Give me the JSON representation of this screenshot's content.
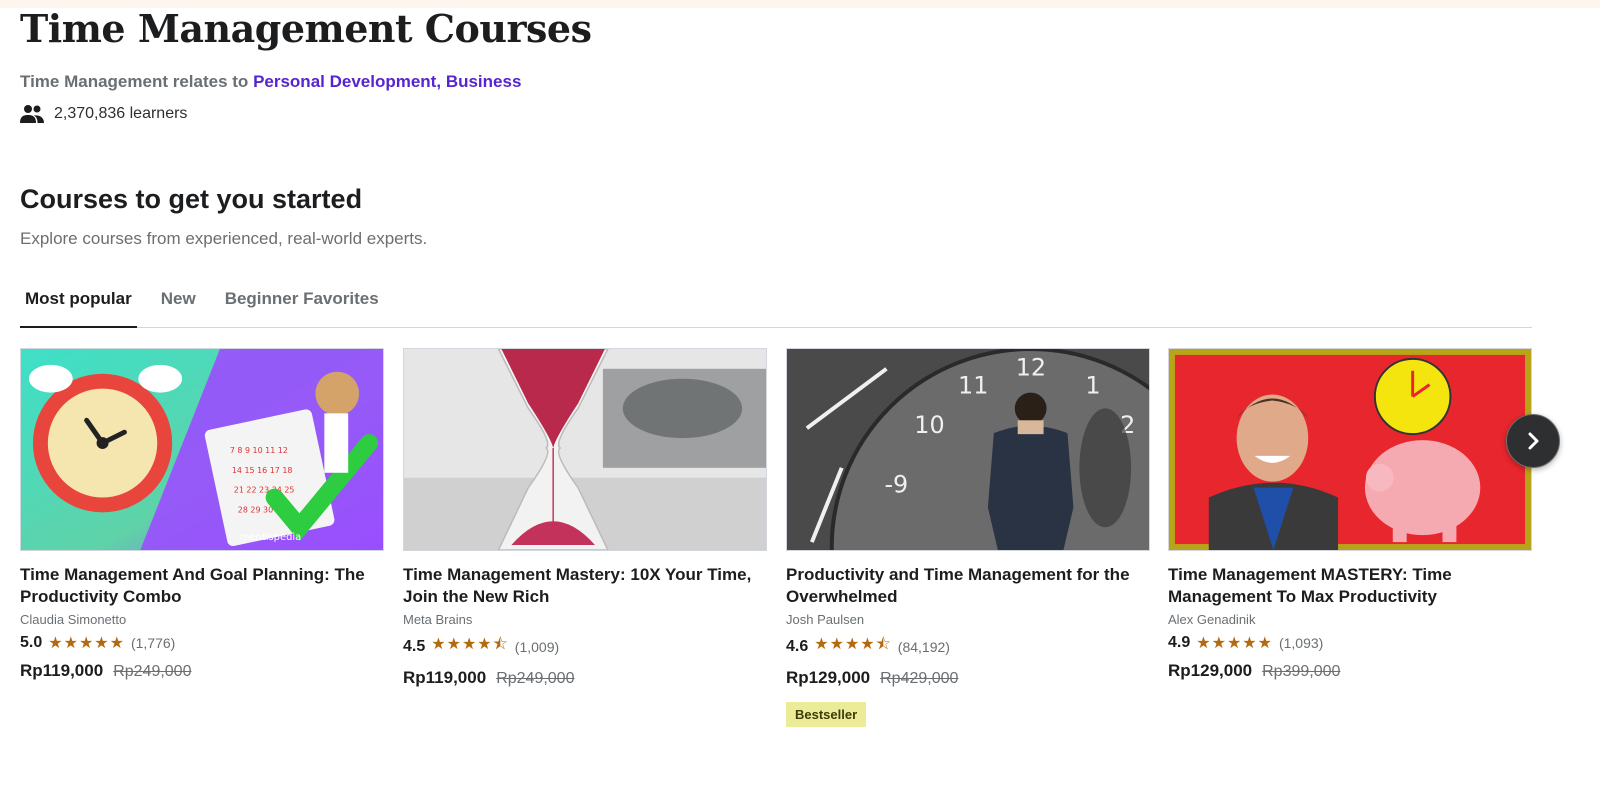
{
  "header": {
    "title": "Time Management Courses",
    "relates_prefix": "Time Management relates to",
    "related_link_1": "Personal Development,",
    "related_link_2": "Business",
    "learners": "2,370,836 learners",
    "learners_icon": "people-icon"
  },
  "section": {
    "title": "Courses to get you started",
    "subtitle": "Explore courses from experienced, real-world experts."
  },
  "tabs": [
    {
      "label": "Most popular",
      "active": true
    },
    {
      "label": "New",
      "active": false
    },
    {
      "label": "Beginner Favorites",
      "active": false
    }
  ],
  "courses": [
    {
      "title": "Time Management And Goal Planning: The Productivity Combo",
      "author": "Claudia Simonetto",
      "rating": "5.0",
      "stars": "★★★★★",
      "reviews": "(1,776)",
      "price": "Rp119,000",
      "original_price": "Rp249,000",
      "thumbnail_logo": "mentispedia"
    },
    {
      "title": "Time Management Mastery: 10X Your Time, Join the New Rich",
      "author": "Meta Brains",
      "rating": "4.5",
      "stars": "★★★★⯪",
      "reviews": "(1,009)",
      "price": "Rp119,000",
      "original_price": "Rp249,000"
    },
    {
      "title": "Productivity and Time Management for the Overwhelmed",
      "author": "Josh Paulsen",
      "rating": "4.6",
      "stars": "★★★★⯪",
      "reviews": "(84,192)",
      "price": "Rp129,000",
      "original_price": "Rp429,000",
      "badge": "Bestseller"
    },
    {
      "title": "Time Management MASTERY: Time Management To Max Productivity",
      "author": "Alex Genadinik",
      "rating": "4.9",
      "stars": "★★★★★",
      "reviews": "(1,093)",
      "price": "Rp129,000",
      "original_price": "Rp399,000"
    }
  ],
  "carousel": {
    "next_icon": "chevron-right-icon"
  },
  "colors": {
    "link": "#5624d0",
    "star": "#b4690e",
    "badge_bg": "#eceb98",
    "text_muted": "#6a6f73"
  }
}
